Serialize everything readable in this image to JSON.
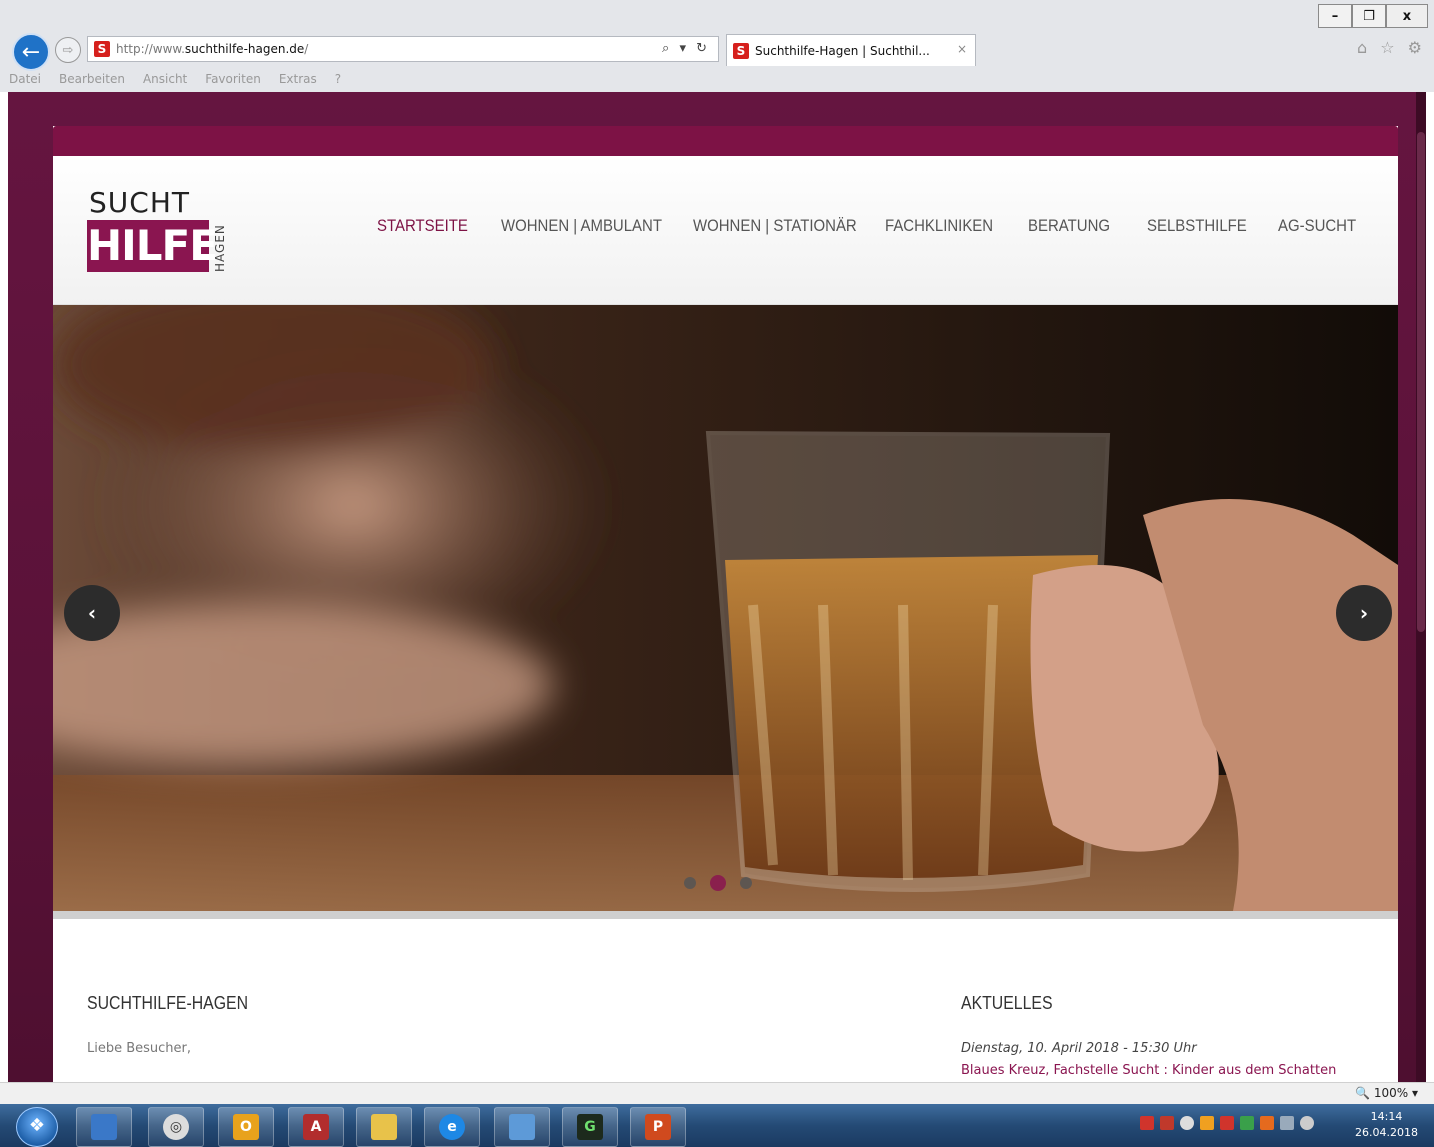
{
  "window": {
    "controls": {
      "minimize": "–",
      "restore": "❐",
      "close": "x"
    }
  },
  "address_bar": {
    "url_prefix": "http://www.",
    "url_domain": "suchthilfe-hagen.de",
    "url_suffix": "/",
    "tools": "⌕ ▾ ↻",
    "favicon_letter": "S"
  },
  "tab": {
    "title": "Suchthilfe-Hagen | Suchthil...",
    "close": "×",
    "favicon_letter": "S"
  },
  "right_icons": "⌂ ☆ ⚙",
  "menubar": [
    "Datei",
    "Bearbeiten",
    "Ansicht",
    "Favoriten",
    "Extras",
    "?"
  ],
  "logo": {
    "line1": "SUCHT",
    "line2": "HILFE",
    "vertical": "HAGEN"
  },
  "nav": [
    {
      "label": "STARTSEITE",
      "active": true
    },
    {
      "label": "WOHNEN | AMBULANT",
      "active": false
    },
    {
      "label": "WOHNEN | STATIONÄR",
      "active": false
    },
    {
      "label": "FACHKLINIKEN",
      "active": false
    },
    {
      "label": "BERATUNG",
      "active": false
    },
    {
      "label": "SELBSTHILFE",
      "active": false
    },
    {
      "label": "AG-SUCHT",
      "active": false
    }
  ],
  "slider": {
    "prev": "‹",
    "next": "›",
    "slide_count": 3,
    "active_slide": 2
  },
  "content": {
    "welcome_title": "SUCHTHILFE-HAGEN",
    "welcome_text": "Liebe Besucher,",
    "news_title": "AKTUELLES",
    "news_date": "Dienstag, 10. April 2018 - 15:30 Uhr",
    "news_link": "Blaues Kreuz, Fachstelle Sucht : Kinder aus dem Schatten"
  },
  "statusbar": {
    "zoom": "🔍 100%  ▾"
  },
  "taskbar": {
    "start_glyph": "❖",
    "clock_time": "14:14",
    "clock_date": "26.04.2018"
  },
  "colors": {
    "brand": "#8a1550",
    "brand_dark": "#7d1245",
    "page_bg": "#5a1238"
  }
}
